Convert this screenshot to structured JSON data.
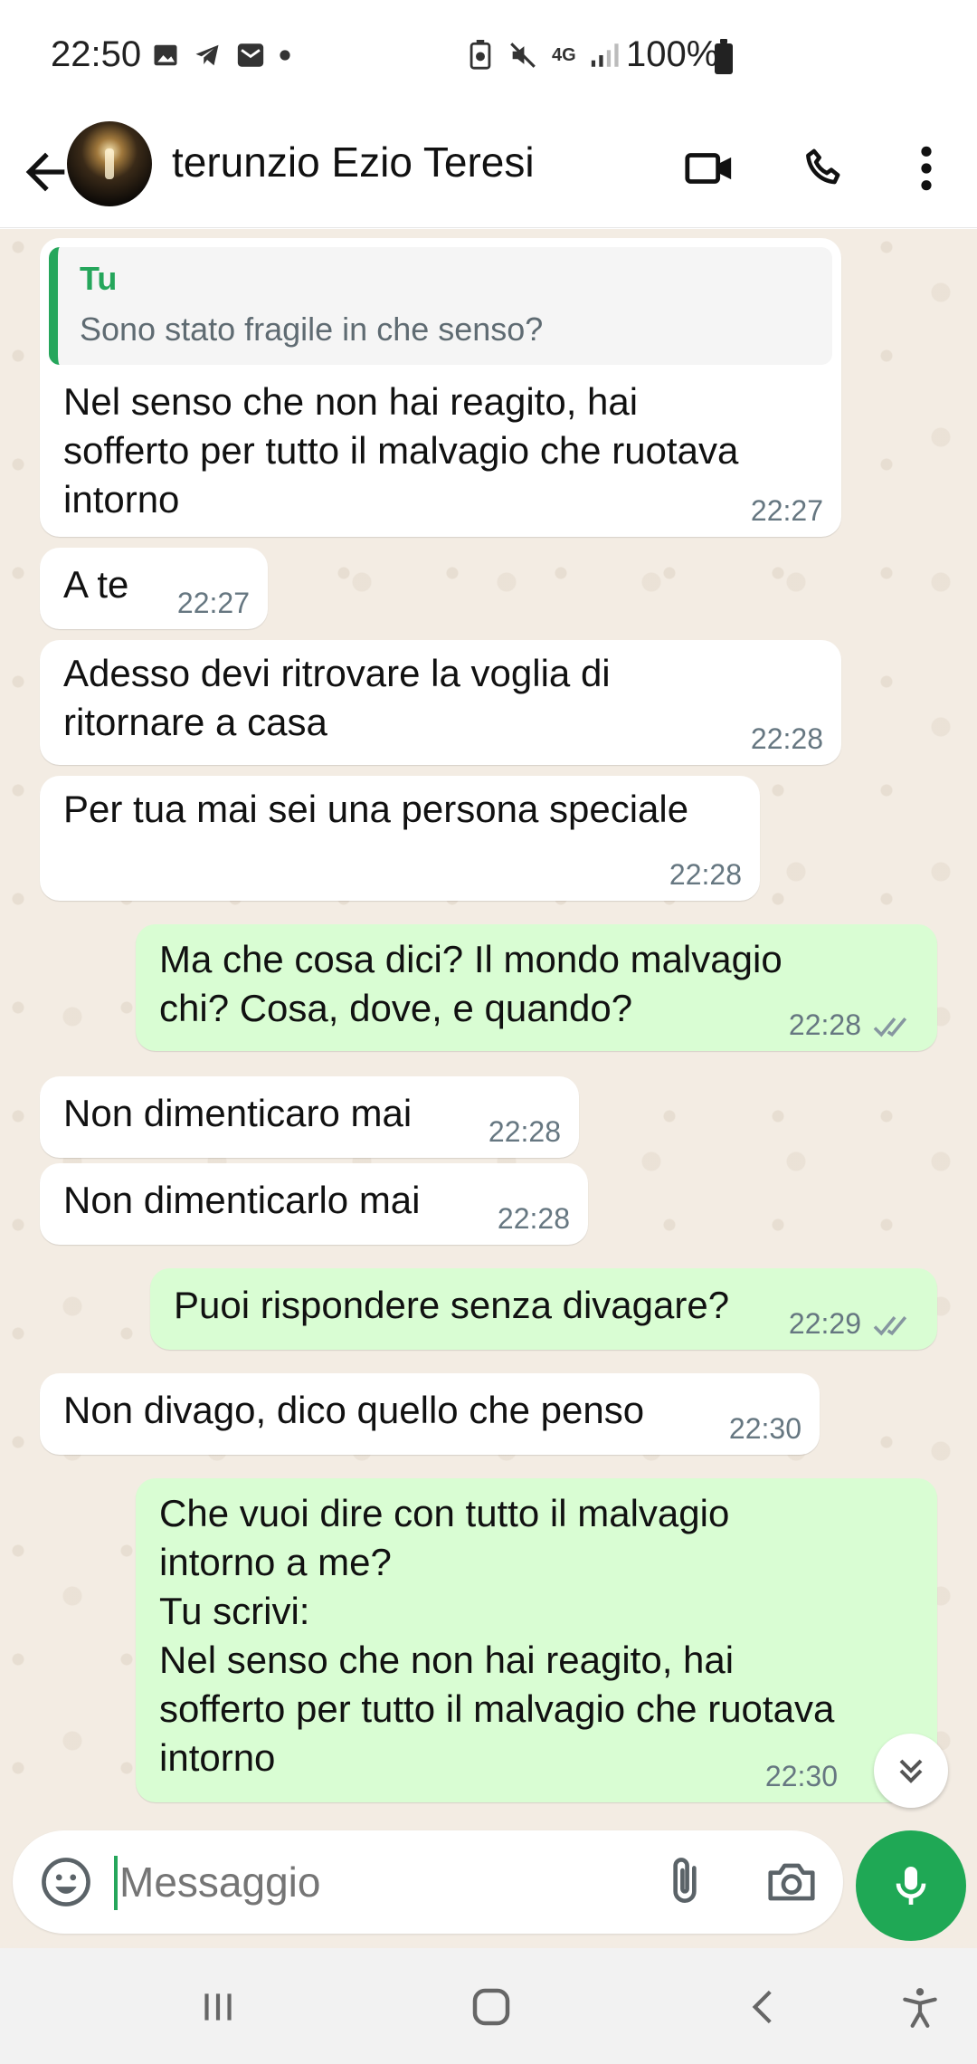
{
  "status_bar": {
    "time": "22:50",
    "battery_text": "100%",
    "network": "4G"
  },
  "header": {
    "contact_name": "terunzio Ezio Teresi"
  },
  "messages": [
    {
      "direction": "in",
      "quote_author": "Tu",
      "quote_text": "Sono stato fragile in che senso?",
      "text": "Nel senso che non hai reagito, hai\nsofferto per tutto il malvagio che ruotava\nintorno",
      "time": "22:27"
    },
    {
      "direction": "in",
      "text": "A te",
      "time": "22:27"
    },
    {
      "direction": "in",
      "text": "Adesso devi ritrovare la voglia di\nritornare a casa",
      "time": "22:28"
    },
    {
      "direction": "in",
      "text": "Per tua mai sei una persona speciale",
      "time": "22:28"
    },
    {
      "direction": "out",
      "text": "Ma che cosa dici? Il mondo malvagio\nchi? Cosa, dove, e quando?",
      "time": "22:28",
      "read": true
    },
    {
      "direction": "in",
      "text": "Non dimenticaro mai",
      "time": "22:28"
    },
    {
      "direction": "in",
      "text": "Non dimenticarlo mai",
      "time": "22:28"
    },
    {
      "direction": "out",
      "text": "Puoi rispondere senza divagare?",
      "time": "22:29",
      "read": true
    },
    {
      "direction": "in",
      "text": "Non divago, dico quello che penso",
      "time": "22:30"
    },
    {
      "direction": "out",
      "text": "Che vuoi dire con tutto il malvagio\nintorno a me?\nTu scrivi:\nNel senso che non hai reagito, hai\nsofferto per tutto il malvagio che ruotava\nintorno",
      "time": "22:30",
      "read": false
    }
  ],
  "composer": {
    "placeholder": "Messaggio"
  },
  "colors": {
    "accent": "#25a65b",
    "outgoing_bubble": "#d9fdd3",
    "incoming_bubble": "#ffffff",
    "chat_background": "#f3ece3",
    "read_ticks": "#8696a0"
  },
  "icons": {
    "back": "arrow-left-icon",
    "video_call": "video-camera-icon",
    "voice_call": "phone-icon",
    "menu": "more-vertical-icon",
    "emoji": "emoji-icon",
    "attach": "paperclip-icon",
    "camera": "camera-icon",
    "mic": "microphone-icon",
    "scroll_down": "double-chevron-down-icon"
  }
}
